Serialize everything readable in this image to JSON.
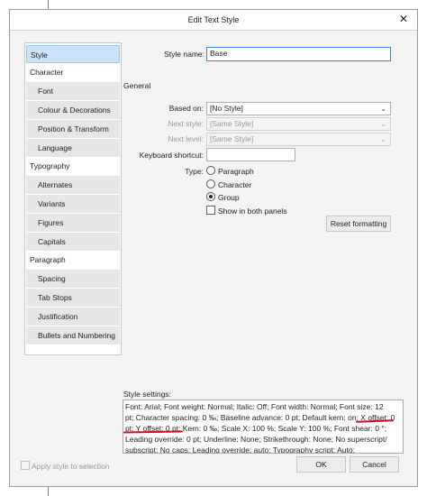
{
  "window": {
    "title": "Edit Text Style",
    "close_glyph": "✕"
  },
  "sidebar": {
    "items": [
      {
        "label": "Style",
        "level": "top",
        "selected": true
      },
      {
        "label": "Character",
        "level": "top"
      },
      {
        "label": "Font",
        "level": "sub"
      },
      {
        "label": "Colour & Decorations",
        "level": "sub"
      },
      {
        "label": "Position & Transform",
        "level": "sub"
      },
      {
        "label": "Language",
        "level": "sub"
      },
      {
        "label": "Typography",
        "level": "top"
      },
      {
        "label": "Alternates",
        "level": "sub"
      },
      {
        "label": "Variants",
        "level": "sub"
      },
      {
        "label": "Figures",
        "level": "sub"
      },
      {
        "label": "Capitals",
        "level": "sub"
      },
      {
        "label": "Paragraph",
        "level": "top"
      },
      {
        "label": "Spacing",
        "level": "sub"
      },
      {
        "label": "Tab Stops",
        "level": "sub"
      },
      {
        "label": "Justification",
        "level": "sub"
      },
      {
        "label": "Bullets and Numbering",
        "level": "sub"
      }
    ]
  },
  "form": {
    "style_name_label": "Style name:",
    "style_name_value": "Base",
    "general_heading": "General",
    "based_on_label": "Based on:",
    "based_on_value": "[No Style]",
    "next_style_label": "Next style:",
    "next_style_value": "[Same Style]",
    "next_level_label": "Next level:",
    "next_level_value": "[Same Style]",
    "keyboard_shortcut_label": "Keyboard shortcut:",
    "keyboard_shortcut_value": "",
    "type_label": "Type:",
    "type_options": [
      "Paragraph",
      "Character",
      "Group"
    ],
    "type_selected": "Group",
    "show_both_panels_label": "Show in both panels",
    "show_both_panels_checked": false,
    "reset_button": "Reset formatting"
  },
  "settings": {
    "label": "Style settings:",
    "lines": [
      "Font: Arial; Font weight: Normal; Italic: Off; Font width: Normal; Font size: 12",
      "pt; Character spacing: 0 ‰; Baseline advance: 0 pt; Default kern: on; X offset: 0",
      "pt; Y offset: 0 pt; Kern: 0 ‰; Scale X: 100 %; Scale Y: 100 %; Font shear: 0 °;",
      "Leading override: 0 pt; Underline: None; Strikethrough: None; No superscript/",
      "subscript; No caps; Leading override: auto; Typography script: Auto;"
    ],
    "annotation_color": "#d0101e"
  },
  "footer": {
    "apply_label": "Apply style to selection",
    "apply_checked": false,
    "ok_label": "OK",
    "cancel_label": "Cancel"
  },
  "icons": {
    "dropdown": "chevron-down-icon",
    "close": "close-icon"
  }
}
